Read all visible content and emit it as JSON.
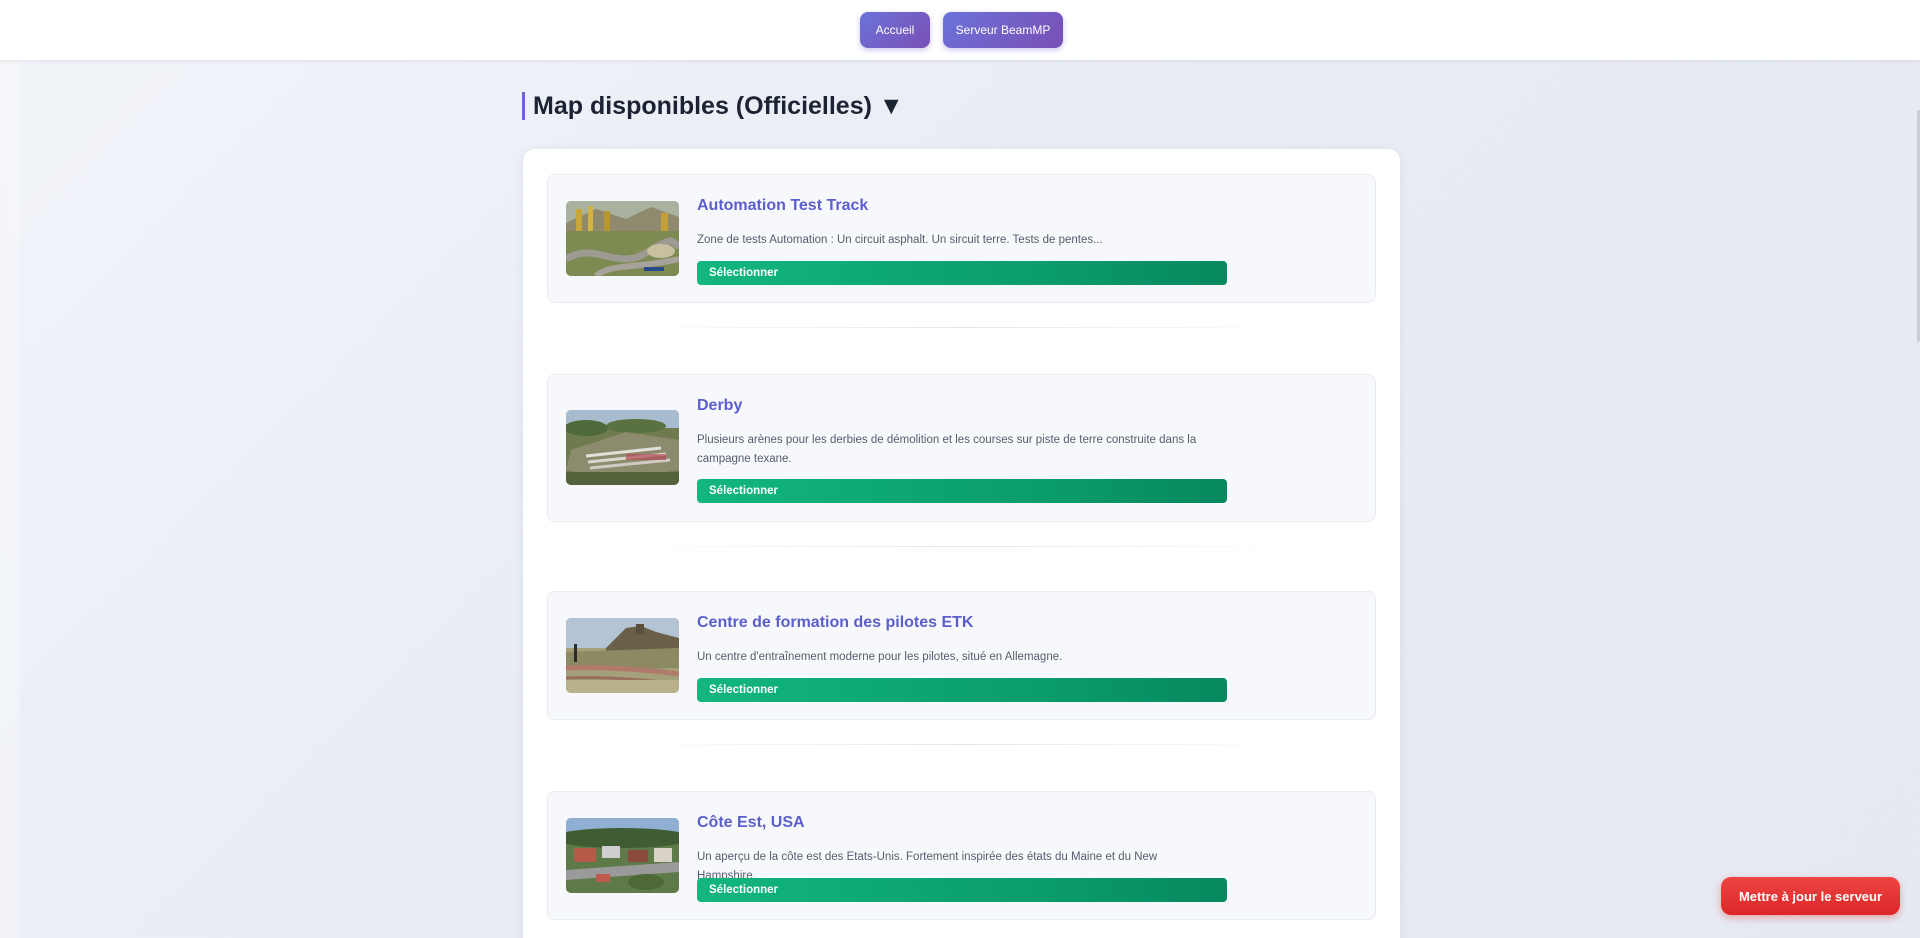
{
  "nav": {
    "home_label": "Accueil",
    "beammp_label": "Serveur BeamMP",
    "button_gradient": [
      "#6b73d9",
      "#7a4fb5"
    ]
  },
  "section": {
    "title": "Map disponibles (Officielles) ▼",
    "accent_color": "#6f63d0"
  },
  "maps": [
    {
      "title": "Automation Test Track",
      "description": "Zone de tests Automation : Un circuit asphalt. Un sircuit terre. Tests de pentes...",
      "button_label": "Sélectionner",
      "thumbnail_icon": "race-track-thumbnail"
    },
    {
      "title": "Derby",
      "description": "Plusieurs arènes pour les derbies de démolition et les courses sur piste de terre construite dans la campagne texane.",
      "button_label": "Sélectionner",
      "thumbnail_icon": "arena-thumbnail"
    },
    {
      "title": "Centre de formation des pilotes ETK",
      "description": "Un centre d'entraînement moderne pour les pilotes, situé en Allemagne.",
      "button_label": "Sélectionner",
      "thumbnail_icon": "training-center-thumbnail"
    },
    {
      "title": "Côte Est, USA",
      "description": "Un aperçu de la côte est des Etats-Unis. Fortement inspirée des états du Maine et du New Hampshire.",
      "button_label": "Sélectionner",
      "thumbnail_icon": "east-coast-town-thumbnail"
    }
  ],
  "colors": {
    "map_title": "#5b5fcb",
    "select_button": "#0a9a6a",
    "update_button": "#dc2626"
  },
  "update_button_label": "Mettre à jour le serveur"
}
